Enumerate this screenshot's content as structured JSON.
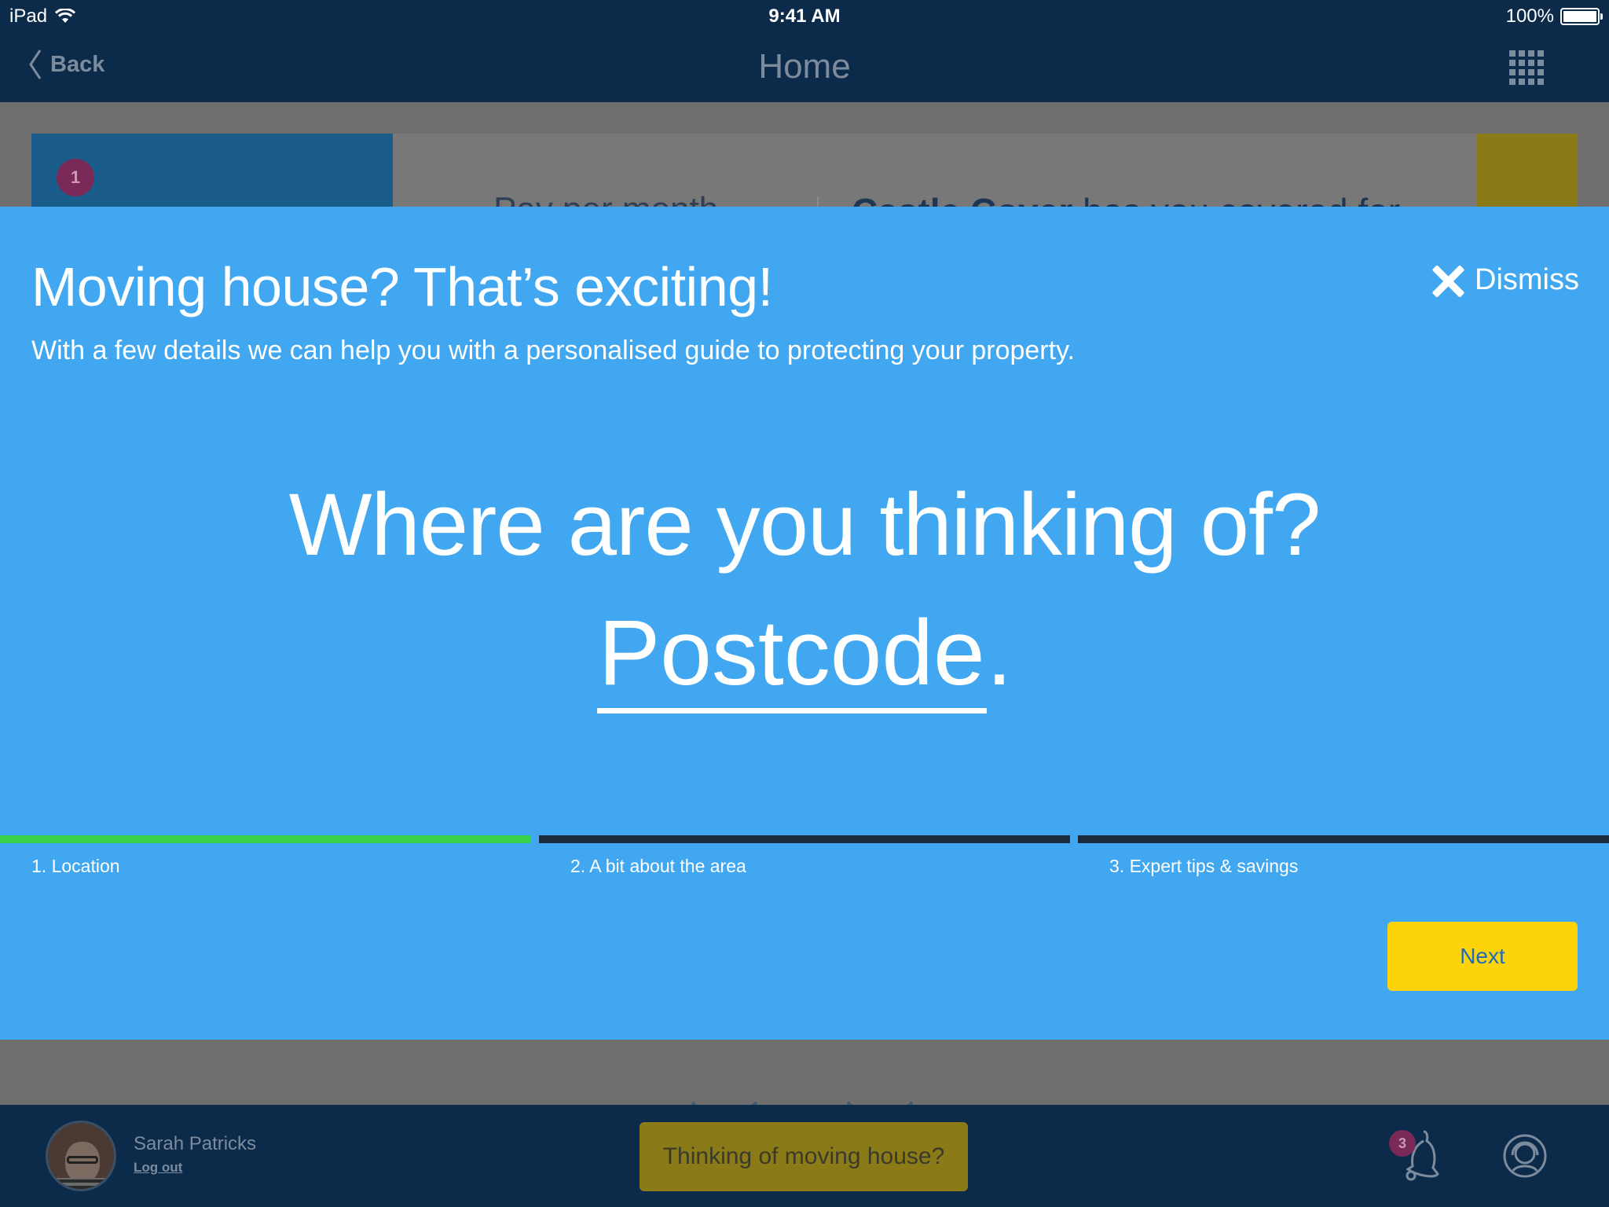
{
  "status_bar": {
    "device": "iPad",
    "time": "9:41 AM",
    "battery": "100%"
  },
  "nav": {
    "back_label": "Back",
    "title": "Home"
  },
  "background": {
    "card_badge": "1",
    "pay_label": "Pay per month",
    "castle_brand": "Castle Cover",
    "castle_rest": " has you covered for"
  },
  "modal": {
    "title": "Moving house? That’s exciting!",
    "subtitle": "With a few details we can help you with a personalised guide to protecting your property.",
    "dismiss_label": "Dismiss",
    "question": "Where are you thinking of?",
    "postcode_placeholder": "Postcode",
    "postcode_suffix": ".",
    "steps": [
      {
        "label": "1. Location",
        "status": "active",
        "color": "#3ad24a"
      },
      {
        "label": "2. A bit about the area",
        "status": "pending",
        "color": "#1d2a3e"
      },
      {
        "label": "3. Expert tips & savings",
        "status": "pending",
        "color": "#1d2a3e"
      }
    ],
    "next_label": "Next"
  },
  "bottom_bar": {
    "user_name": "Sarah Patricks",
    "logout_label": "Log out",
    "moving_button_label": "Thinking of moving house?",
    "notification_count": "3"
  },
  "colors": {
    "modal_bg": "#41a7f0",
    "nav_bg": "#0c2a4a",
    "next_button": "#fdd40a",
    "progress_active": "#3ad24a",
    "progress_inactive": "#1d2a3e"
  }
}
